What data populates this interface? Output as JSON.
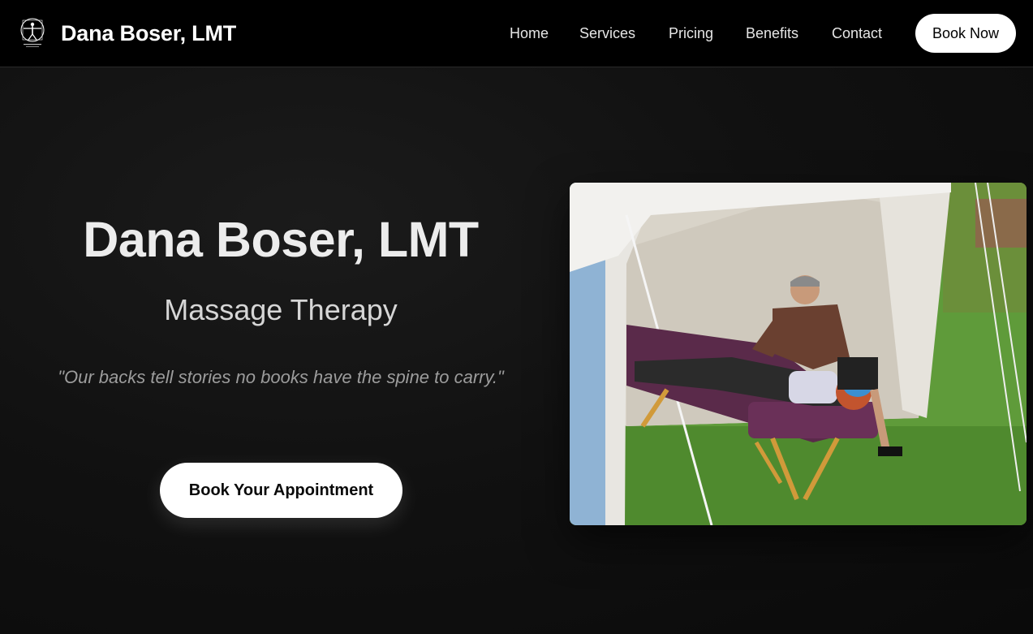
{
  "header": {
    "brand": "Dana Boser, LMT",
    "logo_icon": "vitruvian-man-logo",
    "nav": [
      "Home",
      "Services",
      "Pricing",
      "Benefits",
      "Contact"
    ],
    "book_now_label": "Book Now"
  },
  "hero": {
    "title": "Dana Boser, LMT",
    "subtitle": "Massage Therapy",
    "quote": "\"Our backs tell stories no books have the spine to carry.\"",
    "cta_label": "Book Your Appointment"
  },
  "colors": {
    "background": "#0c0c0c",
    "header_bg": "#000000",
    "button_bg": "#ffffff",
    "button_text": "#000000",
    "title_text": "#ececec",
    "quote_text": "#9c9c9c"
  }
}
